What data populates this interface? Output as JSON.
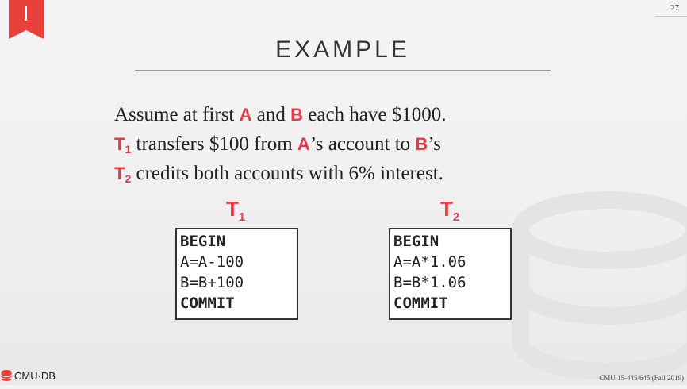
{
  "slide_number": "27",
  "title": "EXAMPLE",
  "bullets": {
    "line1_pre": "Assume at first ",
    "line1_a": "A",
    "line1_and": " and ",
    "line1_b": "B",
    "line1_post": " each have $1000.",
    "line2_t": "T",
    "line2_sub": "1",
    "line2_mid": " transfers $100 from ",
    "line2_a": "A",
    "line2_mid2": "’s account to ",
    "line2_b": "B",
    "line2_post": "’s",
    "line3_t": "T",
    "line3_sub": "2",
    "line3_post": " credits both accounts with 6% interest."
  },
  "t1": {
    "label": "T",
    "sub": "1",
    "lines": [
      "BEGIN",
      "A=A-100",
      "B=B+100",
      "COMMIT"
    ]
  },
  "t2": {
    "label": "T",
    "sub": "2",
    "lines": [
      "BEGIN",
      "A=A*1.06",
      "B=B*1.06",
      "COMMIT"
    ]
  },
  "logo_text": "CMU·DB",
  "footer": "CMU 15-445/645 (Fall 2019)",
  "colors": {
    "accent": "#e63946",
    "text": "#222222"
  }
}
